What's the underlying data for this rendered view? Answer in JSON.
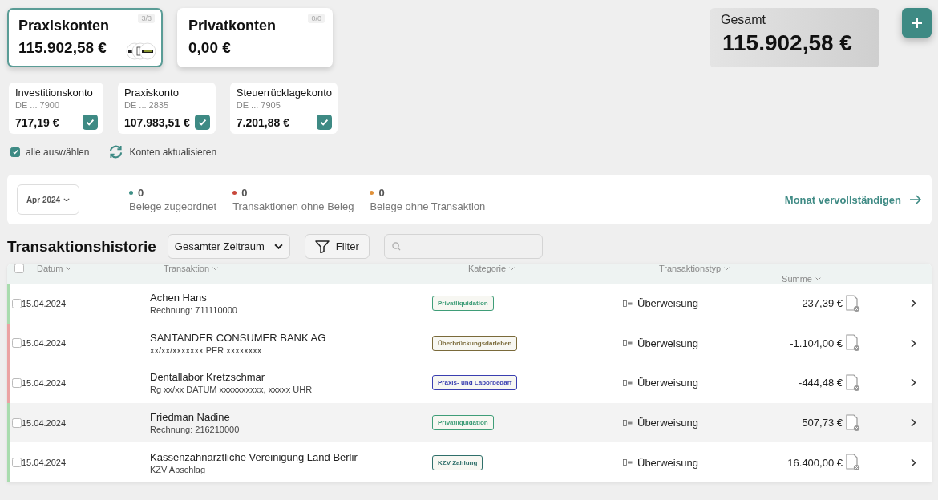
{
  "account_groups": [
    {
      "title": "Praxiskonten",
      "count": "3/3",
      "amount": "115.902,58 €",
      "selected": true,
      "logos": true
    },
    {
      "title": "Privatkonten",
      "count": "0/0",
      "amount": "0,00 €",
      "selected": false,
      "logos": false
    }
  ],
  "total": {
    "label": "Gesamt",
    "amount": "115.902,58 €"
  },
  "accounts": [
    {
      "name": "Investitionskonto",
      "iban": "DE ... 7900",
      "balance": "717,19 €",
      "checked": true
    },
    {
      "name": "Praxiskonto",
      "iban": "DE ... 2835",
      "balance": "107.983,51 €",
      "checked": true
    },
    {
      "name": "Steuerrücklagekonto",
      "iban": "DE ... 7905",
      "balance": "7.201,88 €",
      "checked": true
    }
  ],
  "select_all": {
    "label": "alle auswählen",
    "checked": true
  },
  "refresh": {
    "label": "Konten aktualisieren"
  },
  "month_bar": {
    "month": "Apr 2024",
    "stats": [
      {
        "count": "0",
        "label": "Belege zugeordnet",
        "color": "#3e8f86"
      },
      {
        "count": "0",
        "label": "Transaktionen ohne Beleg",
        "color": "#c8473b"
      },
      {
        "count": "0",
        "label": "Belege ohne Transaktion",
        "color": "#e0913a"
      }
    ],
    "action": "Monat vervollständigen"
  },
  "history": {
    "title": "Transaktionshistorie",
    "period": "Gesamter Zeitraum",
    "filter": "Filter"
  },
  "table": {
    "all_checked": false,
    "columns": [
      "Datum",
      "Transaktion",
      "Kategorie",
      "Transaktionstyp",
      "Summe"
    ],
    "rows": [
      {
        "date": "15.04.2024",
        "name": "Achen Hans",
        "reference": "Rechnung: 711110000",
        "category": {
          "label": "Privatliquidation",
          "color": "#3f9d78"
        },
        "type": "Überweisung",
        "amount": "237,39 €",
        "color": "#a9dcae",
        "checked": false,
        "highlighted": false
      },
      {
        "date": "15.04.2024",
        "name": "SANTANDER CONSUMER BANK AG",
        "reference": "xx/xx/xxxxxxx PER xxxxxxxx",
        "category": {
          "label": "Überbrückungsdarlehen",
          "color": "#7a6a3a"
        },
        "type": "Überweisung",
        "amount": "-1.104,00 €",
        "color": "#eba3a3",
        "checked": false,
        "highlighted": false
      },
      {
        "date": "15.04.2024",
        "name": "Dentallabor Kretzschmar",
        "reference": "Rg xx/xx DATUM xxxxxxxxxx, xxxxx UHR",
        "category": {
          "label": "Praxis- und Laborbedarf",
          "color": "#3a3fb0"
        },
        "type": "Überweisung",
        "amount": "-444,48 €",
        "color": "#eba3a3",
        "checked": false,
        "highlighted": false
      },
      {
        "date": "15.04.2024",
        "name": "Friedman Nadine",
        "reference": "Rechnung: 216210000",
        "category": {
          "label": "Privatliquidation",
          "color": "#3f9d78"
        },
        "type": "Überweisung",
        "amount": "507,73 €",
        "color": "#a9dcae",
        "checked": false,
        "highlighted": true
      },
      {
        "date": "15.04.2024",
        "name": "Kassenzahnarztliche Vereinigung Land Berlir",
        "reference": "KZV Abschlag",
        "category": {
          "label": "KZV Zahlung",
          "color": "#2f6f6a"
        },
        "type": "Überweisung",
        "amount": "16.400,00 €",
        "color": "#a9dcae",
        "checked": false,
        "highlighted": false
      }
    ]
  }
}
